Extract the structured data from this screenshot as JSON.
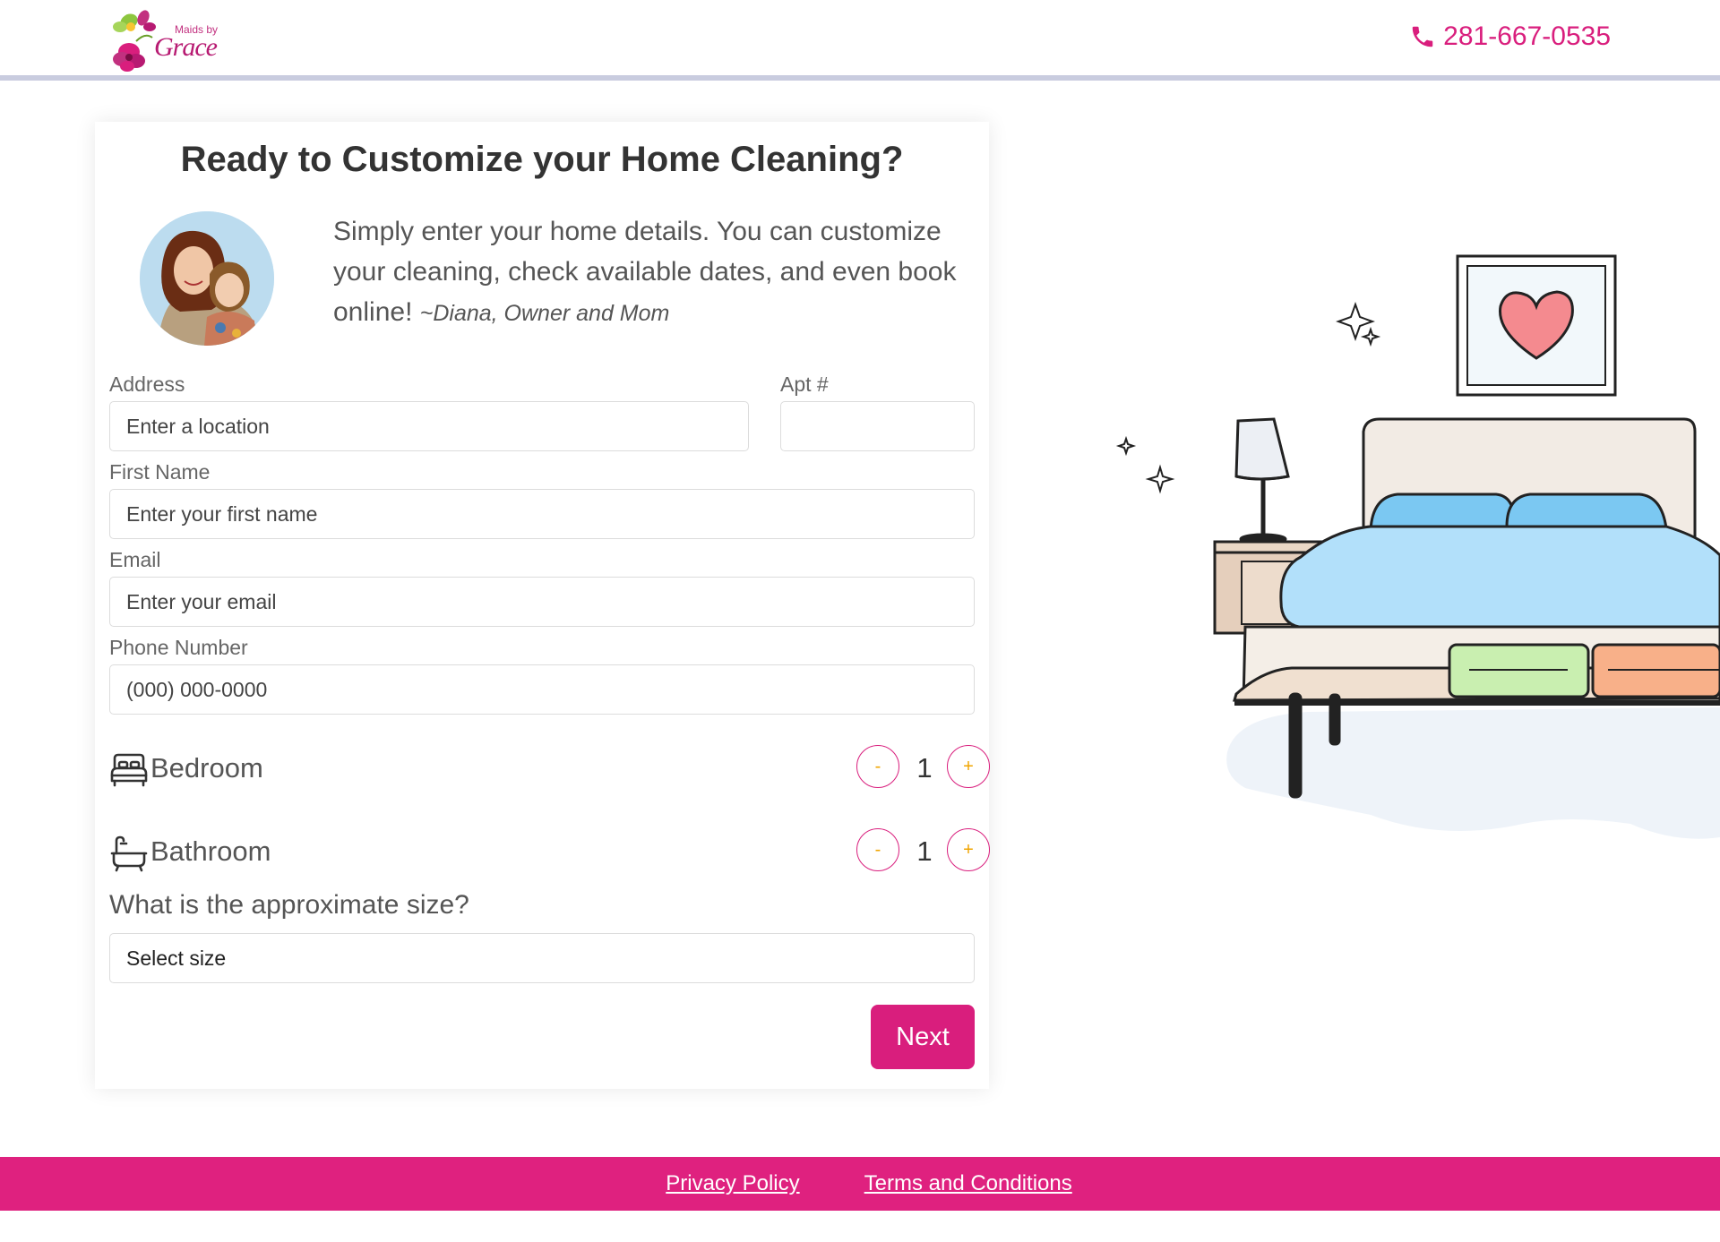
{
  "header": {
    "logo_line1": "Maids by",
    "logo_line2": "Grace",
    "phone": "281-667-0535"
  },
  "card": {
    "title": "Ready to Customize your Home Cleaning?",
    "intro": "Simply enter your home details. You can customize your cleaning, check available dates, and even book online!",
    "signature": "~Diana, Owner and Mom"
  },
  "form": {
    "address_label": "Address",
    "address_placeholder": "Enter a location",
    "apt_label": "Apt #",
    "apt_placeholder": "",
    "first_name_label": "First Name",
    "first_name_placeholder": "Enter your first name",
    "email_label": "Email",
    "email_placeholder": "Enter your email",
    "phone_label": "Phone Number",
    "phone_placeholder": "(000) 000-0000",
    "bedroom_label": "Bedroom",
    "bedroom_count": "1",
    "bathroom_label": "Bathroom",
    "bathroom_count": "1",
    "minus": "-",
    "plus": "+",
    "size_question": "What is the approximate size?",
    "size_selected": "Select size",
    "next_label": "Next"
  },
  "footer": {
    "privacy": "Privacy Policy",
    "terms": "Terms and Conditions"
  },
  "colors": {
    "brand": "#d91e7d",
    "footer": "#df217f",
    "accent": "#f0a500"
  },
  "icons": [
    "phone-icon",
    "bed-icon",
    "bathtub-icon"
  ]
}
